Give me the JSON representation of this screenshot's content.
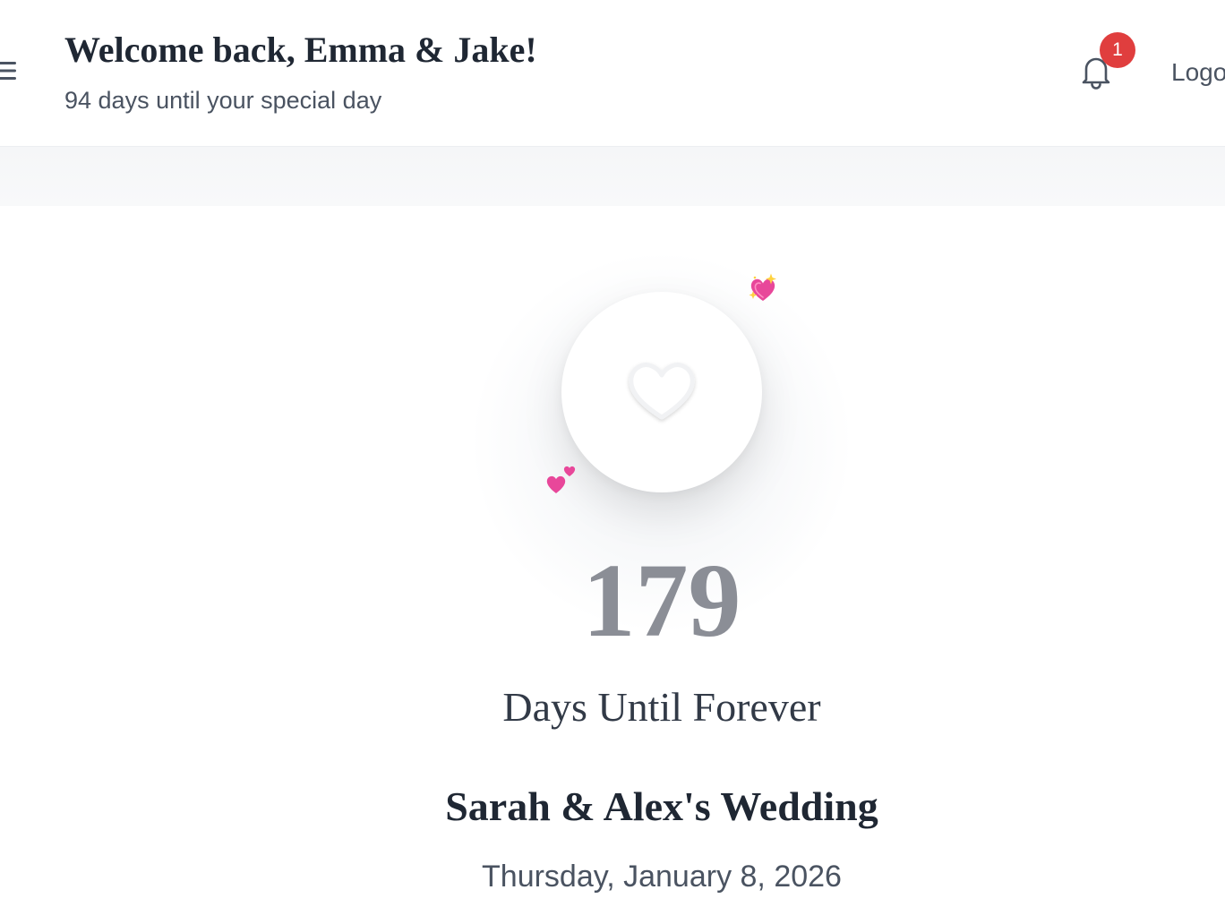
{
  "header": {
    "welcome_title": "Welcome back, Emma & Jake!",
    "welcome_subtitle": "94 days until your special day",
    "notifications": {
      "count": "1",
      "icon": "bell-icon"
    },
    "logout_label": "Logo",
    "menu_icon": "hamburger-menu-icon"
  },
  "countdown": {
    "days": "179",
    "label": "Days Until Forever",
    "event_title": "Sarah & Alex's Wedding",
    "event_date": "Thursday, January 8, 2026",
    "icons": [
      "heart-icon",
      "sparkling-heart-icon",
      "two-hearts-icon"
    ]
  },
  "colors": {
    "text_dark": "#1f2733",
    "text_muted": "#4a5361",
    "count_number": "#8b8e96",
    "badge": "#e03e3e",
    "emoji_pink": "#e83e8c"
  }
}
